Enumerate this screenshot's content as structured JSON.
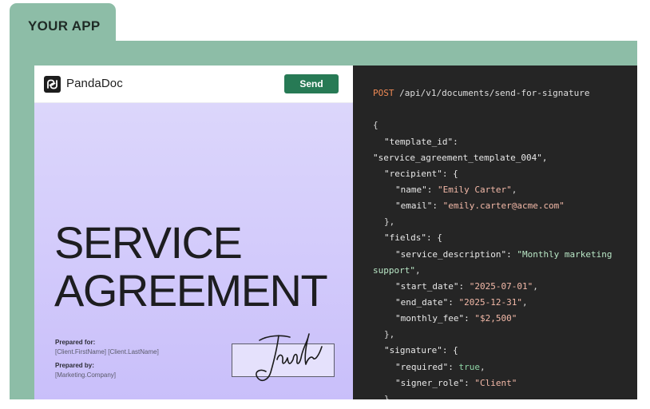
{
  "tab": {
    "label": "YOUR APP"
  },
  "document": {
    "brand": "PandaDoc",
    "send_label": "Send",
    "title_line1": "SERVICE",
    "title_line2": "AGREEMENT",
    "prepared_for_label": "Prepared for:",
    "prepared_for_value": "[Client.FirstName] [Client.LastName]",
    "prepared_by_label": "Prepared by:",
    "prepared_by_value": "[Marketing.Company]"
  },
  "request": {
    "method": "POST",
    "path": " /api/v1/documents/send-for-signature",
    "open_brace": "{",
    "template_id_key": "\"template_id\": ",
    "template_id_value": "\"service_agreement_template_004\",",
    "recipient_key": "\"recipient\": {",
    "name_key": "\"name\": ",
    "name_value": "\"Emily Carter\"",
    "email_key": "\"email\": ",
    "email_value": "\"emily.carter@acme.com\"",
    "close_recipient": "},",
    "fields_key": "\"fields\": {",
    "service_description_key": "\"service_description\": ",
    "service_description_value_1": "\"Monthly marketing",
    "service_description_value_2": "support\"",
    "start_date_key": "\"start_date\": ",
    "start_date_value": "\"2025-07-01\"",
    "end_date_key": "\"end_date\": ",
    "end_date_value": "\"2025-12-31\"",
    "monthly_fee_key": "\"monthly_fee\": ",
    "monthly_fee_value": "\"$2,500\"",
    "close_fields": "},",
    "signature_key": "\"signature\": {",
    "required_key": "\"required\": ",
    "required_value": "true",
    "signer_role_key": "\"signer_role\": ",
    "signer_role_value": "\"Client\"",
    "close_signature": "}",
    "comma": ","
  },
  "colors": {
    "frame": "#8dbda7",
    "send_button": "#277a55",
    "code_background": "#252525",
    "method": "#f08a55"
  }
}
